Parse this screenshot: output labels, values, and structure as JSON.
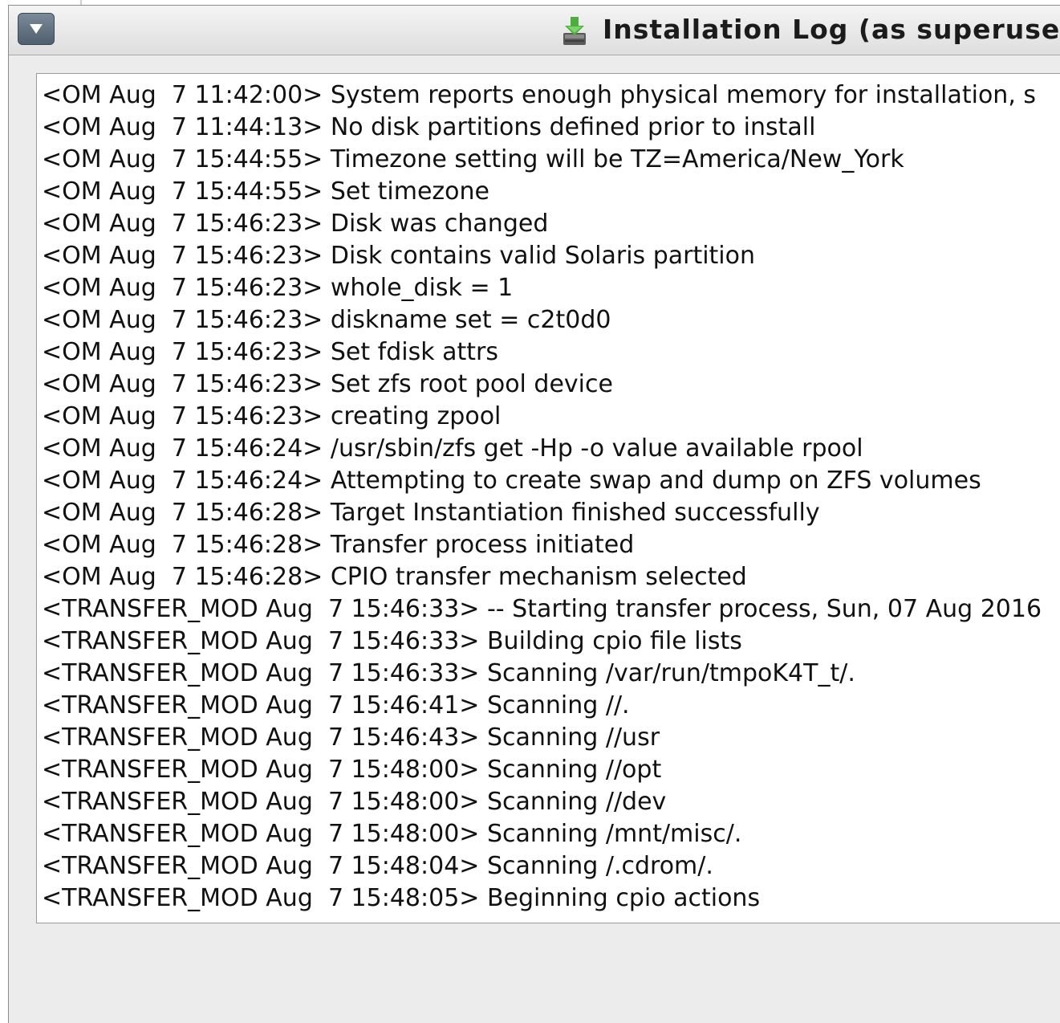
{
  "window": {
    "title": "Installation Log (as superuse"
  },
  "log": {
    "lines": [
      "<OM Aug  7 11:42:00> System reports enough physical memory for installation, s",
      "<OM Aug  7 11:44:13> No disk partitions defined prior to install",
      "<OM Aug  7 15:44:55> Timezone setting will be TZ=America/New_York",
      "<OM Aug  7 15:44:55> Set timezone",
      "<OM Aug  7 15:46:23> Disk was changed",
      "<OM Aug  7 15:46:23> Disk contains valid Solaris partition",
      "<OM Aug  7 15:46:23> whole_disk = 1",
      "<OM Aug  7 15:46:23> diskname set = c2t0d0",
      "<OM Aug  7 15:46:23> Set fdisk attrs",
      "<OM Aug  7 15:46:23> Set zfs root pool device",
      "<OM Aug  7 15:46:23> creating zpool",
      "<OM Aug  7 15:46:24> /usr/sbin/zfs get -Hp -o value available rpool",
      "<OM Aug  7 15:46:24> Attempting to create swap and dump on ZFS volumes",
      "<OM Aug  7 15:46:28> Target Instantiation finished successfully",
      "<OM Aug  7 15:46:28> Transfer process initiated",
      "<OM Aug  7 15:46:28> CPIO transfer mechanism selected",
      "<TRANSFER_MOD Aug  7 15:46:33> -- Starting transfer process, Sun, 07 Aug 2016",
      "<TRANSFER_MOD Aug  7 15:46:33> Building cpio file lists",
      "<TRANSFER_MOD Aug  7 15:46:33> Scanning /var/run/tmpoK4T_t/.",
      "<TRANSFER_MOD Aug  7 15:46:41> Scanning //.",
      "<TRANSFER_MOD Aug  7 15:46:43> Scanning //usr",
      "<TRANSFER_MOD Aug  7 15:48:00> Scanning //opt",
      "<TRANSFER_MOD Aug  7 15:48:00> Scanning //dev",
      "<TRANSFER_MOD Aug  7 15:48:00> Scanning /mnt/misc/.",
      "<TRANSFER_MOD Aug  7 15:48:04> Scanning /.cdrom/.",
      "<TRANSFER_MOD Aug  7 15:48:05> Beginning cpio actions"
    ]
  },
  "icons": {
    "window_menu": "chevron-down-icon",
    "title": "installer-download-icon"
  }
}
